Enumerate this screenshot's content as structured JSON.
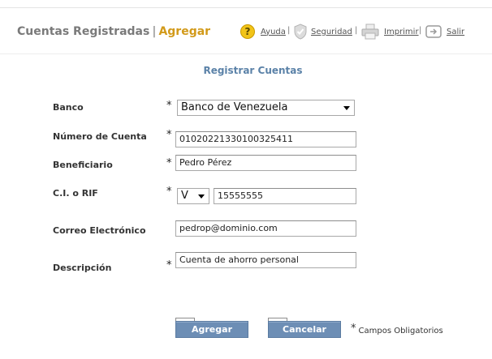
{
  "header": {
    "title": "Cuentas Registradas",
    "separator": "|",
    "active_tab": "Agregar"
  },
  "toolbar": {
    "items": [
      {
        "label": "Ayuda",
        "icon": "help-icon"
      },
      {
        "label": "Seguridad",
        "icon": "shield-icon"
      },
      {
        "label": "Imprimir",
        "icon": "printer-icon"
      },
      {
        "label": "Salir",
        "icon": "exit-icon"
      }
    ],
    "separator": "|"
  },
  "form": {
    "title": "Registrar Cuentas",
    "required_mark": "*",
    "fields": {
      "banco": {
        "label": "Banco",
        "value": "Banco de Venezuela"
      },
      "numero": {
        "label": "Número de Cuenta",
        "value": "01020221330100325411"
      },
      "beneficiario": {
        "label": "Beneficiario",
        "value": "Pedro Pérez"
      },
      "ci_rif": {
        "label": "C.I. o RIF",
        "type_value": "V",
        "value": "15555555"
      },
      "correo": {
        "label": "Correo Electrónico",
        "value": "pedrop@dominio.com"
      },
      "descripcion": {
        "label": "Descripción",
        "value": "Cuenta de ahorro personal"
      }
    }
  },
  "buttons": {
    "agregar": "Agregar",
    "cancelar": "Cancelar"
  },
  "note": {
    "mark": "*",
    "text": "Campos Obligatorios"
  },
  "colors": {
    "accent": "#d29a1a",
    "form_title": "#5b82a8",
    "button": "#6d8eb5"
  }
}
